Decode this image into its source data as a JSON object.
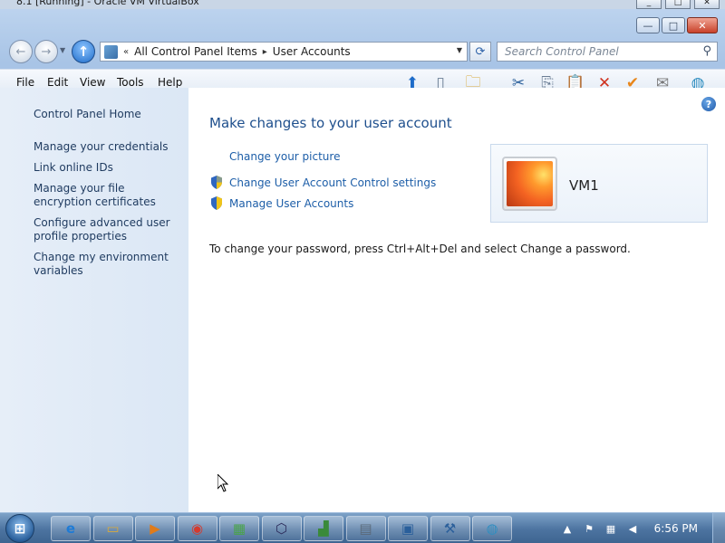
{
  "host": {
    "title": "8.1 [Running] - Oracle VM VirtualBox",
    "buttons": [
      "_",
      "□",
      "✕"
    ]
  },
  "window": {
    "caption_buttons": {
      "minimize": "—",
      "maximize": "□",
      "close": "✕"
    }
  },
  "navbar": {
    "back_glyph": "←",
    "forward_glyph": "→",
    "up_glyph": "↑",
    "breadcrumb_prefix": "«",
    "breadcrumbs": [
      "All Control Panel Items",
      "User Accounts"
    ],
    "separator": "▸",
    "refresh_glyph": "⟳",
    "search_placeholder": "Search Control Panel",
    "search_glyph": "⚲"
  },
  "menubar": {
    "items": [
      "File",
      "Edit",
      "View",
      "Tools",
      "Help"
    ],
    "toolbar_icons": [
      {
        "name": "up-arrow-icon",
        "glyph": "⬆",
        "color": "#1e6cc9"
      },
      {
        "name": "pane-icon",
        "glyph": "▯",
        "color": "#6a7d94"
      },
      {
        "name": "folder-options-icon",
        "glyph": "🗀",
        "color": "#d9a93a"
      },
      {
        "name": "cut-icon",
        "glyph": "✂",
        "color": "#2a5f9b"
      },
      {
        "name": "copy-icon",
        "glyph": "⎘",
        "color": "#6a7d94"
      },
      {
        "name": "paste-icon",
        "glyph": "📋",
        "color": "#8a6a3a"
      },
      {
        "name": "delete-icon",
        "glyph": "✕",
        "color": "#d0331f"
      },
      {
        "name": "check-icon",
        "glyph": "✔",
        "color": "#e8861a"
      },
      {
        "name": "mail-icon",
        "glyph": "✉",
        "color": "#7a7a7a"
      },
      {
        "name": "globe-icon",
        "glyph": "◍",
        "color": "#2f8ec0"
      }
    ]
  },
  "left_pane": {
    "home": "Control Panel Home",
    "links": [
      "Manage your credentials",
      "Link online IDs",
      "Manage your file encryption certificates",
      "Configure advanced user profile properties",
      "Change my environment variables"
    ]
  },
  "main": {
    "help_glyph": "?",
    "title": "Make changes to your user account",
    "tasks": [
      "Change your picture",
      "Change User Account Control settings",
      "Manage User Accounts"
    ],
    "user_name": "VM1",
    "info": "To change your password, press Ctrl+Alt+Del and select Change a password."
  },
  "taskbar": {
    "start_glyph": "⊞",
    "apps": [
      {
        "name": "internet-explorer-icon",
        "glyph": "e",
        "color": "#1e7bd6"
      },
      {
        "name": "file-explorer-icon",
        "glyph": "▭",
        "color": "#d9a93a"
      },
      {
        "name": "media-player-icon",
        "glyph": "▶",
        "color": "#e07b1a"
      },
      {
        "name": "chrome-icon",
        "glyph": "◉",
        "color": "#d33b2f"
      },
      {
        "name": "control-panel-icon",
        "glyph": "▦",
        "color": "#4aa34a"
      },
      {
        "name": "virtualbox-icon",
        "glyph": "⬡",
        "color": "#2b2b5a"
      },
      {
        "name": "task-manager-icon",
        "glyph": "▟",
        "color": "#3a8a3a"
      },
      {
        "name": "document-icon",
        "glyph": "▤",
        "color": "#5a6a7a"
      },
      {
        "name": "remote-desktop-icon",
        "glyph": "▣",
        "color": "#2a5f9b"
      },
      {
        "name": "tools-icon",
        "glyph": "⚒",
        "color": "#2a5f9b"
      },
      {
        "name": "network-app-icon",
        "glyph": "◍",
        "color": "#2f8ec0"
      }
    ],
    "tray": {
      "show_hidden": "▲",
      "flag": "⚑",
      "network": "▦",
      "volume": "◀"
    },
    "clock": "6:56 PM"
  }
}
